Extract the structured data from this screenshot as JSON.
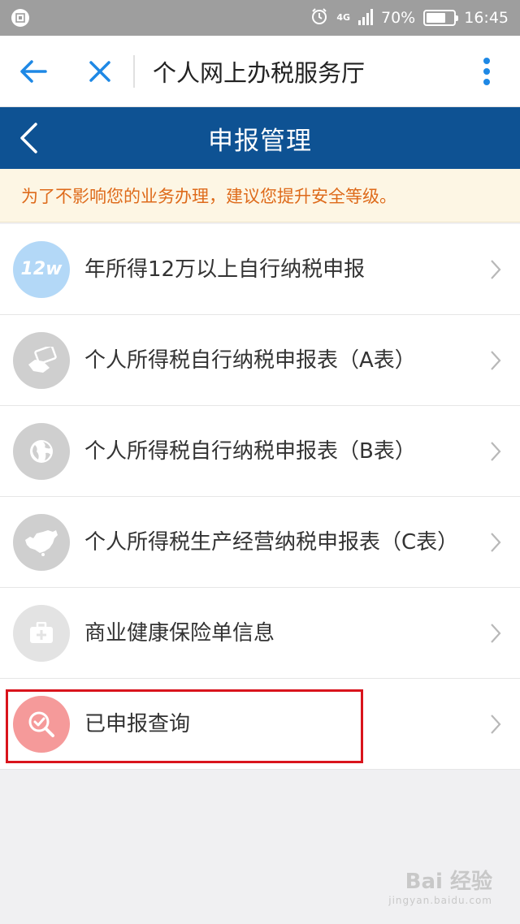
{
  "status_bar": {
    "network": "4G",
    "battery": "70%",
    "battery_level": 0.7,
    "time": "16:45"
  },
  "browser": {
    "title": "个人网上办税服务厅"
  },
  "page": {
    "title": "申报管理",
    "notice": "为了不影响您的业务办理，建议您提升安全等级。"
  },
  "menu": {
    "items": [
      {
        "label": "年所得12万以上自行纳税申报",
        "icon_text": "12w",
        "icon": "12w-badge-icon",
        "color": "#b3d8f7"
      },
      {
        "label": "个人所得税自行纳税申报表（A表）",
        "icon": "money-hand-icon",
        "color": "#cfcfcf"
      },
      {
        "label": "个人所得税自行纳税申报表（B表）",
        "icon": "globe-icon",
        "color": "#cfcfcf"
      },
      {
        "label": "个人所得税生产经营纳税申报表（C表）",
        "icon": "china-map-icon",
        "color": "#cfcfcf"
      },
      {
        "label": "商业健康保险单信息",
        "icon": "medical-kit-icon",
        "color": "#e3e3e3"
      },
      {
        "label": "已申报查询",
        "icon": "search-check-icon",
        "color": "#f59a9a"
      }
    ]
  },
  "watermark": {
    "brand": "Bai 经验",
    "url": "jingyan.baidu.com"
  },
  "colors": {
    "header": "#0e5293",
    "notice_text": "#de6a1a",
    "accent": "#1e88e5",
    "highlight": "#d9141c"
  }
}
